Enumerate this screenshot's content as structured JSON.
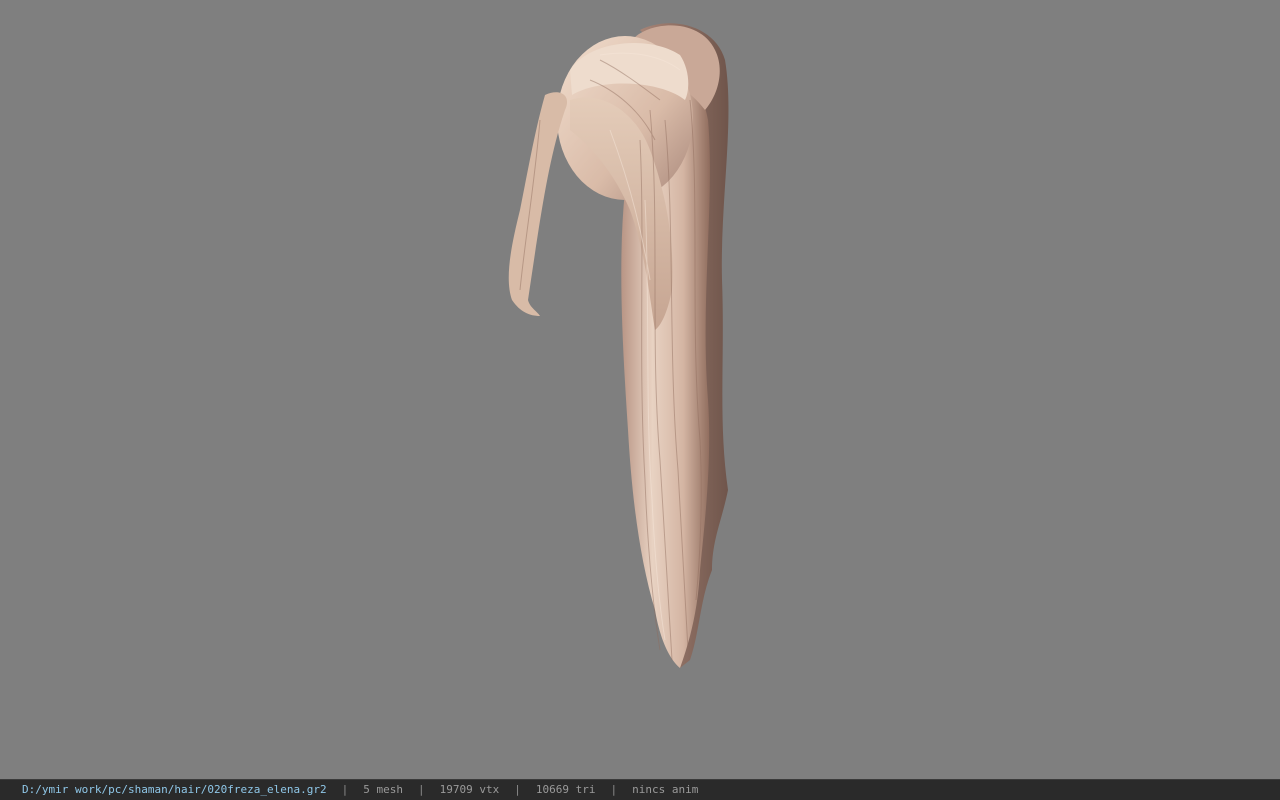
{
  "viewer": {
    "background_color": "#7f7f7f",
    "hair_colors": {
      "light": "#e9d2c0",
      "mid": "#c8a996",
      "dark": "#8f6c5d",
      "shadow": "#6a5249"
    }
  },
  "statusbar": {
    "file_path": "D:/ymir work/pc/shaman/hair/020freza_elena.gr2",
    "mesh_count": "5 mesh",
    "vertex_count": "19709 vtx",
    "triangle_count": "10669 tri",
    "anim_status": "nincs anim",
    "separator": "|"
  }
}
